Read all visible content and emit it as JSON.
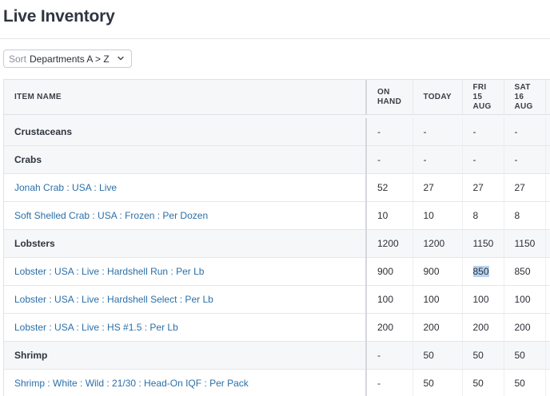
{
  "page": {
    "title": "Live Inventory"
  },
  "sort": {
    "prefix": "Sort",
    "value": "Departments A > Z"
  },
  "columns": {
    "item_name": "ITEM NAME",
    "on_hand": [
      "ON",
      "HAND"
    ],
    "today": "TODAY",
    "fri": [
      "FRI",
      "15",
      "AUG"
    ],
    "sat": [
      "SAT",
      "16",
      "AUG"
    ]
  },
  "rows": [
    {
      "type": "group",
      "name": "Crustaceans",
      "on_hand": "-",
      "today": "-",
      "fri": "-",
      "sat": "-"
    },
    {
      "type": "group",
      "name": "Crabs",
      "on_hand": "-",
      "today": "-",
      "fri": "-",
      "sat": "-"
    },
    {
      "type": "item",
      "name": "Jonah Crab : USA : Live",
      "on_hand": "52",
      "today": "27",
      "fri": "27",
      "sat": "27"
    },
    {
      "type": "item",
      "name": "Soft Shelled Crab : USA : Frozen : Per Dozen",
      "on_hand": "10",
      "today": "10",
      "fri": "8",
      "sat": "8"
    },
    {
      "type": "group",
      "name": "Lobsters",
      "on_hand": "1200",
      "today": "1200",
      "fri": "1150",
      "sat": "1150"
    },
    {
      "type": "item",
      "name": "Lobster : USA : Live : Hardshell Run : Per Lb",
      "on_hand": "900",
      "today": "900",
      "fri": "850",
      "sat": "850",
      "selected": "fri"
    },
    {
      "type": "item",
      "name": "Lobster : USA : Live : Hardshell Select : Per Lb",
      "on_hand": "100",
      "today": "100",
      "fri": "100",
      "sat": "100"
    },
    {
      "type": "item",
      "name": "Lobster : USA : Live : HS #1.5 : Per Lb",
      "on_hand": "200",
      "today": "200",
      "fri": "200",
      "sat": "200"
    },
    {
      "type": "group",
      "name": "Shrimp",
      "on_hand": "-",
      "today": "50",
      "fri": "50",
      "sat": "50"
    },
    {
      "type": "item",
      "name": "Shrimp : White : Wild : 21/30 : Head-On IQF : Per Pack",
      "on_hand": "-",
      "today": "50",
      "fri": "50",
      "sat": "50"
    }
  ],
  "icons": {
    "sort_dropdown": "chevron-down-icon"
  },
  "colors": {
    "link": "#2a6fa8",
    "header_bg": "#f6f7f9",
    "selection": "#b8d3f0"
  }
}
